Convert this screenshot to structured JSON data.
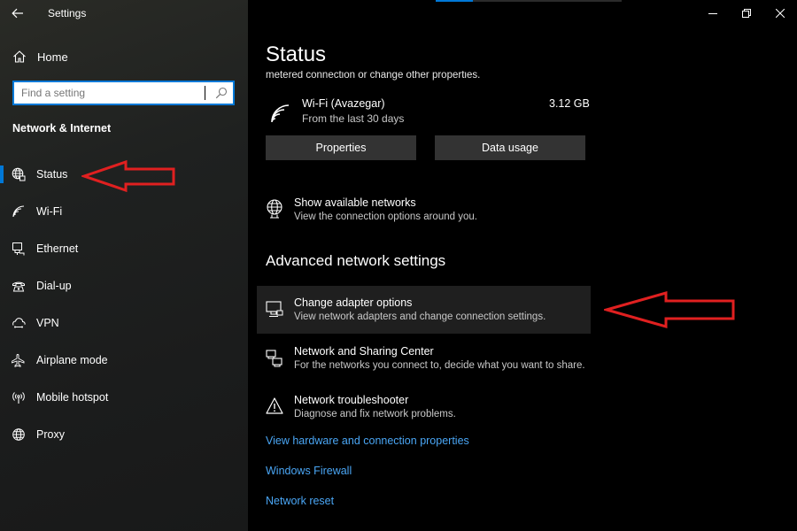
{
  "app": {
    "title": "Settings"
  },
  "sidebar": {
    "home_label": "Home",
    "search_placeholder": "Find a setting",
    "section_label": "Network & Internet",
    "items": [
      {
        "label": "Status",
        "icon": "globe-status-icon",
        "active": true
      },
      {
        "label": "Wi-Fi",
        "icon": "wifi-icon"
      },
      {
        "label": "Ethernet",
        "icon": "ethernet-icon"
      },
      {
        "label": "Dial-up",
        "icon": "dialup-icon"
      },
      {
        "label": "VPN",
        "icon": "vpn-icon"
      },
      {
        "label": "Airplane mode",
        "icon": "airplane-icon"
      },
      {
        "label": "Mobile hotspot",
        "icon": "hotspot-icon"
      },
      {
        "label": "Proxy",
        "icon": "globe-icon"
      }
    ]
  },
  "main": {
    "title": "Status",
    "cut_text": "metered connection or change other properties.",
    "network": {
      "name": "Wi-Fi (Avazegar)",
      "sub": "From the last 30 days",
      "usage": "3.12 GB"
    },
    "buttons": {
      "properties": "Properties",
      "data_usage": "Data usage"
    },
    "show_networks": {
      "title": "Show available networks",
      "desc": "View the connection options around you."
    },
    "advanced_header": "Advanced network settings",
    "options": [
      {
        "title": "Change adapter options",
        "desc": "View network adapters and change connection settings."
      },
      {
        "title": "Network and Sharing Center",
        "desc": "For the networks you connect to, decide what you want to share."
      },
      {
        "title": "Network troubleshooter",
        "desc": "Diagnose and fix network problems."
      }
    ],
    "links": [
      "View hardware and connection properties",
      "Windows Firewall",
      "Network reset"
    ]
  },
  "colors": {
    "accent": "#0078d7",
    "link": "#4aa6f5",
    "annotation": "#e02020"
  }
}
